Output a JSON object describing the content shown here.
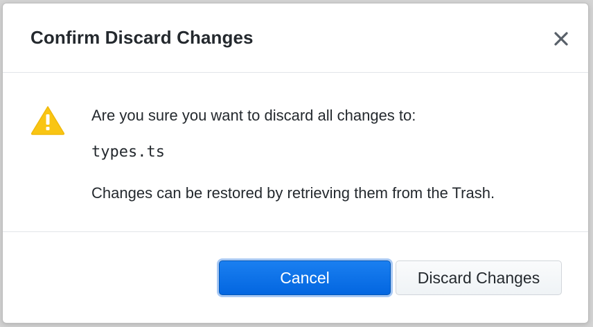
{
  "dialog": {
    "title": "Confirm Discard Changes",
    "close_icon": "close-icon",
    "warning_icon": "warning-icon",
    "message_line": "Are you sure you want to discard all changes to:",
    "file_name": "types.ts",
    "note_line": "Changes can be restored by retrieving them from the Trash.",
    "buttons": {
      "cancel_label": "Cancel",
      "discard_label": "Discard Changes"
    },
    "colors": {
      "primary": "#0366d6",
      "warning": "#f6c343",
      "text": "#24292e"
    }
  }
}
